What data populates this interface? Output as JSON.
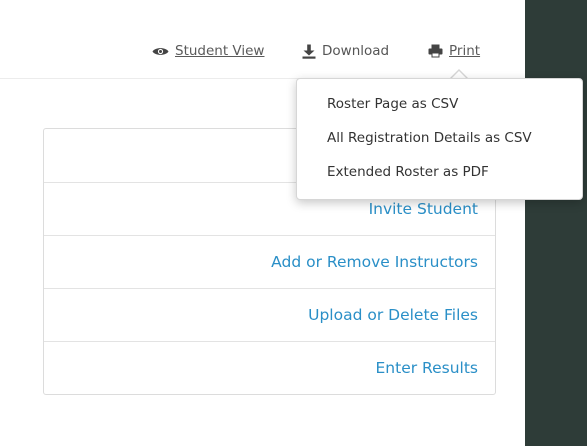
{
  "toolbar": {
    "student_view": {
      "label": "Student View",
      "icon": "eye-icon"
    },
    "download": {
      "label": "Download",
      "icon": "download-icon"
    },
    "print": {
      "label": "Print",
      "icon": "printer-icon"
    }
  },
  "download_menu": {
    "items": [
      {
        "label": "Roster Page as CSV"
      },
      {
        "label": "All Registration Details as CSV"
      },
      {
        "label": "Extended Roster as PDF"
      }
    ]
  },
  "actions": [
    {
      "label": ""
    },
    {
      "label": "Invite Student"
    },
    {
      "label": "Add or Remove Instructors"
    },
    {
      "label": "Upload or Delete Files"
    },
    {
      "label": "Enter Results"
    }
  ],
  "colors": {
    "link": "#2a8fc7",
    "dark_panel": "#2e3c38",
    "text": "#333333"
  }
}
